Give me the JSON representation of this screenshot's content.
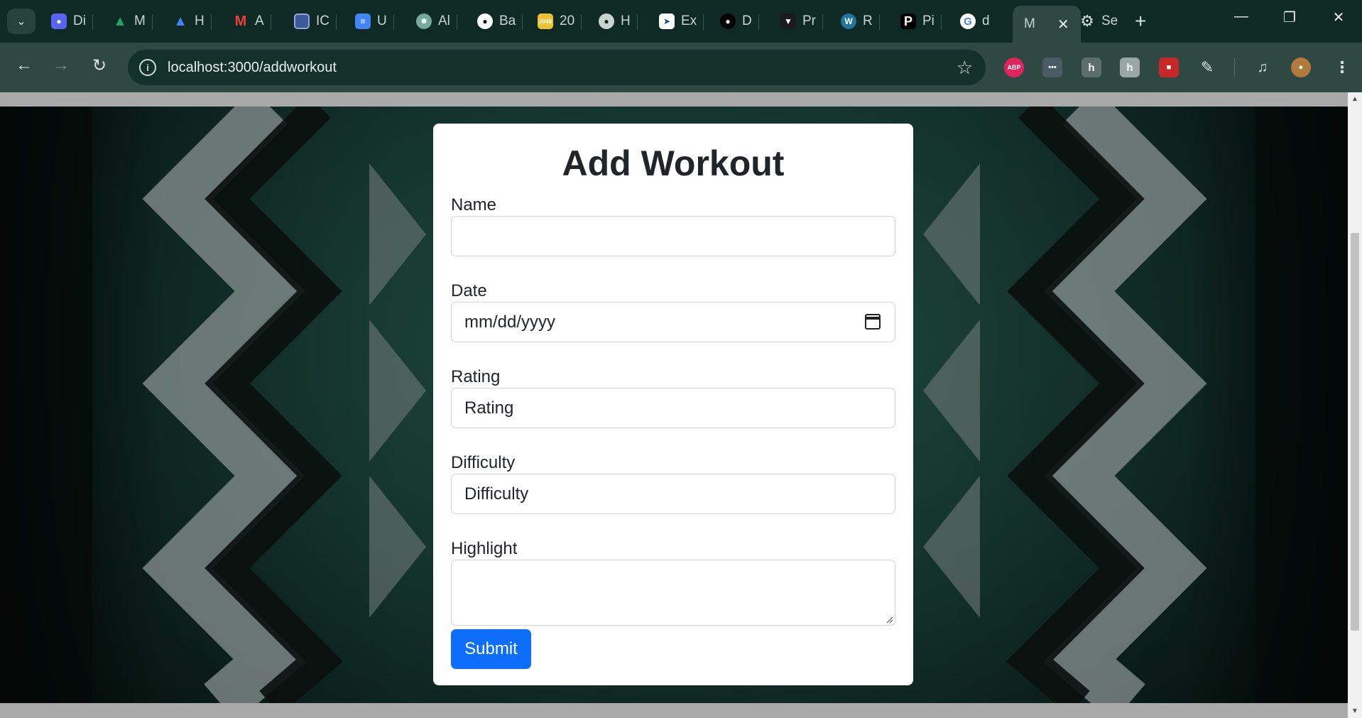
{
  "browser": {
    "tabs": [
      {
        "label": "Di",
        "icon": "discord-icon",
        "color": "#5865f2"
      },
      {
        "label": "M",
        "icon": "google-drive-icon",
        "color": "#1fa463"
      },
      {
        "label": "H",
        "icon": "google-drive-icon",
        "color": "#1fa463"
      },
      {
        "label": "A",
        "icon": "gmail-icon",
        "color": "#ea4335"
      },
      {
        "label": "IC",
        "icon": "document-icon",
        "color": "#3c5a9a"
      },
      {
        "label": "U",
        "icon": "google-docs-icon",
        "color": "#4285f4"
      },
      {
        "label": "Al",
        "icon": "chatgpt-icon",
        "color": "#74aa9c"
      },
      {
        "label": "Ba",
        "icon": "github-icon",
        "color": "#ffffff"
      },
      {
        "label": "20",
        "icon": "game-2048-icon",
        "color": "#edc22e"
      },
      {
        "label": "H",
        "icon": "globe-icon",
        "color": "#c9d4d0"
      },
      {
        "label": "Ex",
        "icon": "runner-icon",
        "color": "#ffffff"
      },
      {
        "label": "D",
        "icon": "skull-icon",
        "color": "#000000"
      },
      {
        "label": "Pr",
        "icon": "panther-icon",
        "color": "#1b1b1b"
      },
      {
        "label": "R",
        "icon": "wordpress-icon",
        "color": "#21759b"
      },
      {
        "label": "Pi",
        "icon": "p-logo-icon",
        "color": "#000000"
      },
      {
        "label": "d",
        "icon": "google-icon",
        "color": "#ffffff"
      }
    ],
    "active_tab": {
      "label": "M"
    },
    "settings_tab": {
      "label": "Se",
      "icon": "gear-icon"
    },
    "url": "localhost:3000/addworkout"
  },
  "form": {
    "title": "Add Workout",
    "name": {
      "label": "Name",
      "value": ""
    },
    "date": {
      "label": "Date",
      "value": "mm/dd/yyyy"
    },
    "rating": {
      "label": "Rating",
      "placeholder": "Rating"
    },
    "difficulty": {
      "label": "Difficulty",
      "placeholder": "Difficulty"
    },
    "highlight": {
      "label": "Highlight",
      "value": ""
    },
    "submit_label": "Submit"
  },
  "colors": {
    "primary": "#0d6efd",
    "tabbar": "#0f2a24",
    "toolbar": "#2f4842"
  }
}
